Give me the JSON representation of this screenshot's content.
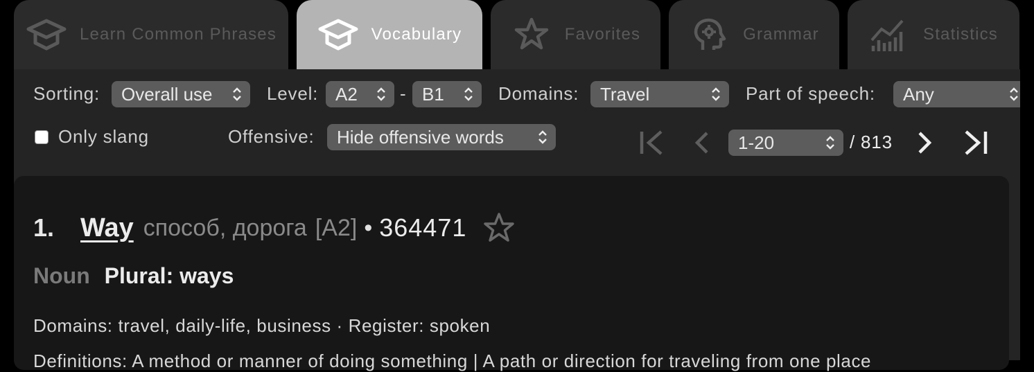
{
  "tabs": [
    {
      "label": "Learn Common Phrases",
      "icon": "graduation-cap-icon",
      "active": false
    },
    {
      "label": "Vocabulary",
      "icon": "graduation-cap-icon",
      "active": true
    },
    {
      "label": "Favorites",
      "icon": "star-icon",
      "active": false
    },
    {
      "label": "Grammar",
      "icon": "head-gear-icon",
      "active": false
    },
    {
      "label": "Statistics",
      "icon": "chart-icon",
      "active": false
    }
  ],
  "filters": {
    "sorting_label": "Sorting:",
    "sorting_value": "Overall use",
    "level_label": "Level:",
    "level_from": "A2",
    "level_sep": "-",
    "level_to": "B1",
    "domains_label": "Domains:",
    "domains_value": "Travel",
    "pos_label": "Part of speech:",
    "pos_value": "Any",
    "slang_label": "Only slang",
    "offensive_label": "Offensive:",
    "offensive_value": "Hide offensive words"
  },
  "pagination": {
    "range": "1-20",
    "total": "/ 813"
  },
  "entry": {
    "number": "1.",
    "word": "Way",
    "translation": "способ, дорога",
    "level": "[A2]",
    "bullet": "•",
    "frequency": "364471",
    "pos": "Noun",
    "plural": "Plural: ways",
    "meta": "Domains: travel, daily-life, business · Register: spoken",
    "definitions": "Definitions: A method or manner of doing something | A path or direction for traveling from one place"
  },
  "colors": {
    "background": "#000000",
    "panel": "#242424",
    "card": "#171717",
    "tab_inactive": "#2b2b2b",
    "tab_active": "#b4b4b4",
    "select": "#5c5c5c"
  }
}
